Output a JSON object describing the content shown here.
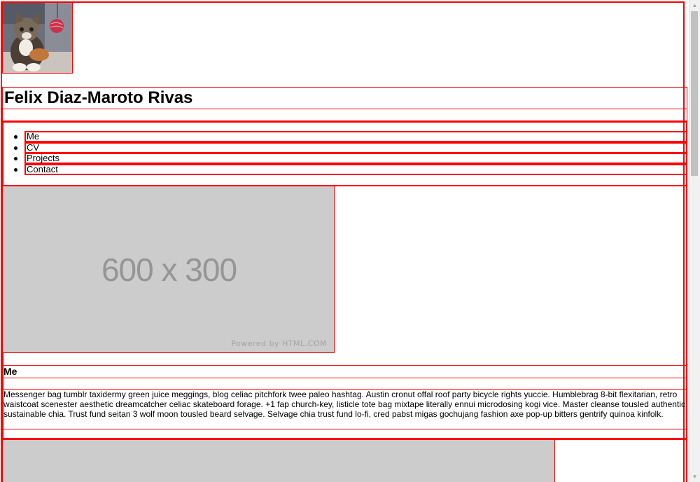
{
  "header": {
    "title": "Felix Diaz-Maroto Rivas"
  },
  "nav": {
    "items": [
      {
        "label": "Me"
      },
      {
        "label": "CV"
      },
      {
        "label": "Projects"
      },
      {
        "label": "Contact"
      }
    ]
  },
  "sections": [
    {
      "image": {
        "label": "600 x 300",
        "credit": "Powered by HTML.COM"
      },
      "heading": "Me",
      "text": "Messenger bag tumblr taxidermy green juice meggings, blog celiac pitchfork twee paleo hashtag. Austin cronut offal roof party bicycle rights yuccie. Humblebrag 8-bit flexitarian, retro waistcoat scenester aesthetic dreamcatcher celiac skateboard forage. +1 fap church-key, listicle tote bag mixtape literally ennui microdosing kogi vice. Master cleanse tousled authentic sustainable chia. Trust fund seitan 3 wolf moon tousled beard selvage. Selvage chia trust fund lo-fi, cred pabst migas gochujang fashion axe pop-up bitters gentrify quinoa kinfolk."
    }
  ],
  "icons": {
    "scroll_up": "scroll-up-arrow-icon",
    "scroll_down": "scroll-down-arrow-icon"
  },
  "colors": {
    "outline": "#ff0000",
    "placeholder_bg": "#cccccc",
    "placeholder_text": "#959595"
  }
}
